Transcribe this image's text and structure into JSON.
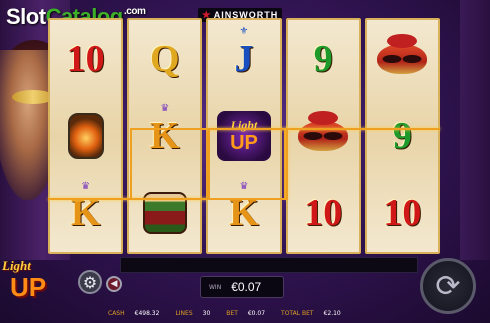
{
  "watermark": {
    "slot": "Slot",
    "catalog": "Catalog",
    "com": ".com"
  },
  "provider": {
    "name": "AINSWORTH",
    "mark": "★"
  },
  "game": {
    "title_line1": "Light",
    "title_line2": "UP"
  },
  "reels": [
    [
      {
        "text": "10",
        "color": "red"
      },
      {
        "icon": "lantern-symbol"
      },
      {
        "text": "K",
        "color": "orange",
        "crown": true
      }
    ],
    [
      {
        "text": "Q",
        "color": "gold"
      },
      {
        "text": "K",
        "color": "orange",
        "crown": true
      },
      {
        "icon": "drum-symbol"
      }
    ],
    [
      {
        "text": "J",
        "color": "blue"
      },
      {
        "icon": "light-up-logo-symbol"
      },
      {
        "text": "K",
        "color": "orange",
        "crown": true
      }
    ],
    [
      {
        "text": "9",
        "color": "green"
      },
      {
        "icon": "mask-symbol"
      },
      {
        "text": "10",
        "color": "red"
      }
    ],
    [
      {
        "icon": "mask-symbol"
      },
      {
        "text": "9",
        "color": "green"
      },
      {
        "text": "10",
        "color": "red"
      }
    ]
  ],
  "symbols": {
    "r1c1": "10",
    "r1c3": "K",
    "r2c1": "Q",
    "r2c2": "K",
    "r3c1": "J",
    "r3c3": "K",
    "r4c1": "9",
    "r4c3": "10",
    "r5c2": "9",
    "r5c3": "10"
  },
  "logo_symbol": {
    "l1": "Light",
    "l2": "UP"
  },
  "win": {
    "label": "WIN",
    "value": "€0.07"
  },
  "status": {
    "cash_label": "CASH",
    "cash_value": "€498.32",
    "lines_label": "LINES",
    "lines_value": "30",
    "bet_label": "BET",
    "bet_value": "€0.07",
    "total_bet_label": "TOTAL BET",
    "total_bet_value": "€2.10"
  },
  "icons": {
    "settings": "gear-icon",
    "sound": "speaker-icon",
    "spin": "spin-icon"
  },
  "colors": {
    "payline": "#f0a020",
    "reel_frame": "#d9b15a",
    "status_label": "#e0a020",
    "background": "#321454"
  }
}
